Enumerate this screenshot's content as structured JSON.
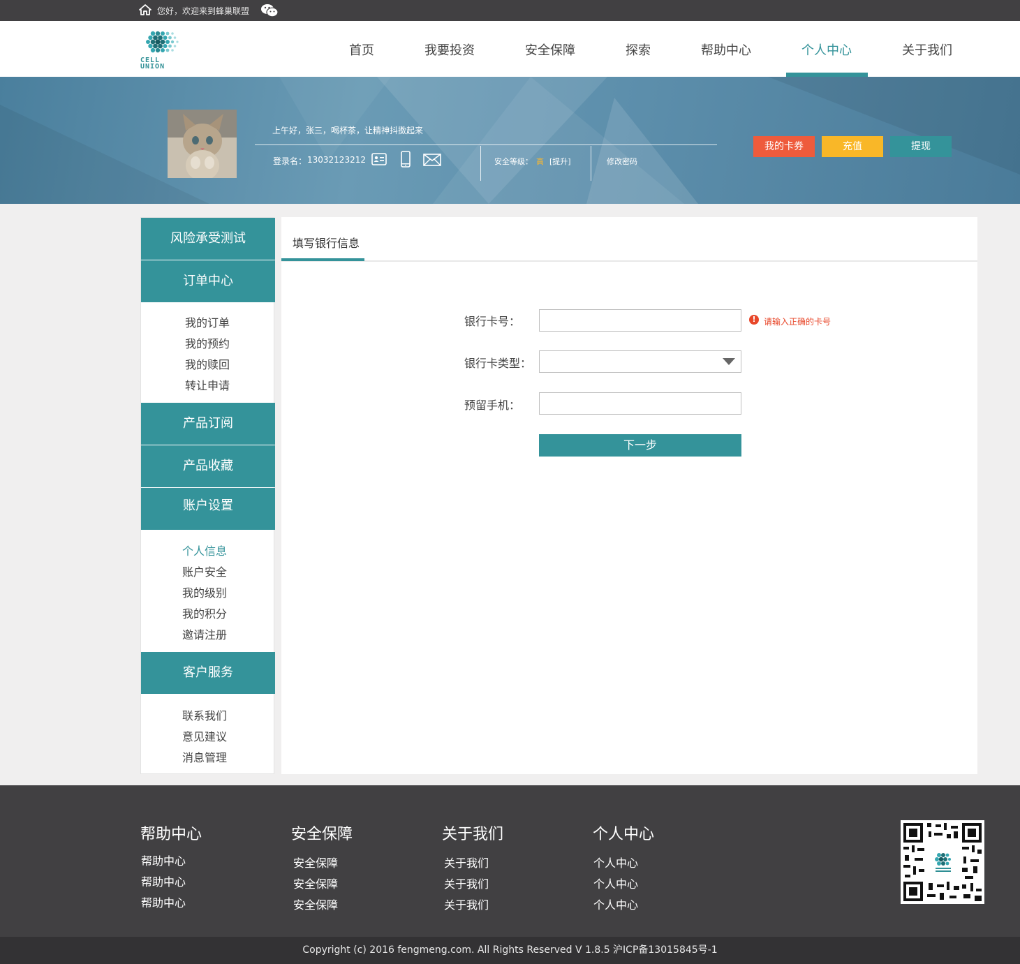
{
  "topbar": {
    "welcome": "您好，欢迎来到蜂巢联盟"
  },
  "logo": {
    "line1": "CELL",
    "line2": "UNION"
  },
  "nav": {
    "items": [
      {
        "label": "首页"
      },
      {
        "label": "我要投资"
      },
      {
        "label": "安全保障"
      },
      {
        "label": "探索"
      },
      {
        "label": "帮助中心"
      },
      {
        "label": "个人中心",
        "active": true
      },
      {
        "label": "关于我们"
      }
    ]
  },
  "banner": {
    "greeting": "上午好，张三，喝杯茶，让精神抖擞起来",
    "login_label": "登录名：",
    "login_value": "13032123212",
    "security_label": "安全等级：",
    "security_level": "高",
    "security_upgrade": "[提升]",
    "change_password": "修改密码",
    "buttons": {
      "coupons": "我的卡券",
      "recharge": "充值",
      "withdraw": "提现"
    }
  },
  "sidebar": {
    "risk_test": "风险承受测试",
    "orders": {
      "title": "订单中心",
      "items": [
        "我的订单",
        "我的预约",
        "我的赎回",
        "转让申请"
      ]
    },
    "subscribe": "产品订阅",
    "favorites": "产品收藏",
    "account": {
      "title": "账户设置",
      "items": [
        "个人信息",
        "账户安全",
        "我的级别",
        "我的积分",
        "邀请注册"
      ],
      "active_index": 0
    },
    "service": {
      "title": "客户服务",
      "items": [
        "联系我们",
        "意见建议",
        "消息管理"
      ]
    }
  },
  "main": {
    "tab": "填写银行信息",
    "form": {
      "card_no_label": "银行卡号：",
      "card_no_value": "",
      "card_no_error": "请输入正确的卡号",
      "card_type_label": "银行卡类型：",
      "card_type_value": "",
      "phone_label": "预留手机：",
      "phone_value": "",
      "next": "下一步"
    }
  },
  "footer": {
    "columns": [
      {
        "title": "帮助中心",
        "links": [
          "帮助中心",
          "帮助中心",
          "帮助中心"
        ]
      },
      {
        "title": "安全保障",
        "links": [
          "安全保障",
          "安全保障",
          "安全保障"
        ]
      },
      {
        "title": "关于我们",
        "links": [
          "关于我们",
          "关于我们",
          "关于我们"
        ]
      },
      {
        "title": "个人中心",
        "links": [
          "个人中心",
          "个人中心",
          "个人中心"
        ]
      }
    ],
    "copyright": "Copyright (c) 2016 fengmeng.com. All Rights Reserved V 1.8.5 沪ICP备13015845号-1"
  },
  "colors": {
    "accent": "#34939a",
    "topbar": "#414042",
    "coupon_btn": "#ee5b3c",
    "recharge_btn": "#f9b728",
    "error": "#e8472a"
  }
}
